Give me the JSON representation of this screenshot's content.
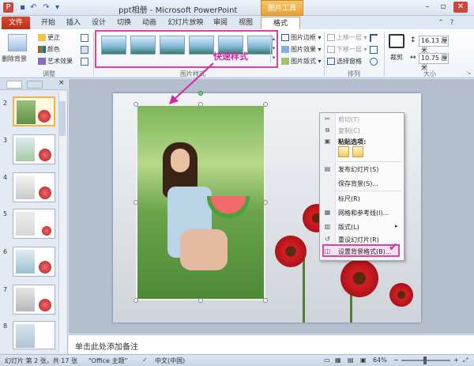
{
  "window": {
    "title": "ppt相册 - Microsoft PowerPoint",
    "context_tool_title": "图片工具"
  },
  "tabs": [
    "文件",
    "开始",
    "插入",
    "设计",
    "切换",
    "动画",
    "幻灯片放映",
    "审阅",
    "视图",
    "格式"
  ],
  "ribbon": {
    "remove_bg": "删除背景",
    "corrections": "更正",
    "color": "颜色",
    "artistic": "艺术效果",
    "adjust_group": "调整",
    "picture_styles_group": "图片样式",
    "border": "图片边框",
    "effects": "图片效果",
    "layout": "图片版式",
    "bring_forward": "上移一层",
    "send_backward": "下移一层",
    "selection_pane": "选择窗格",
    "arrange_group": "排列",
    "crop": "裁剪",
    "height": "16.13 厘米",
    "width": "10.75 厘米",
    "size_group": "大小"
  },
  "annotation": "快速样式",
  "slides": [
    "2",
    "3",
    "4",
    "5",
    "6",
    "7",
    "8"
  ],
  "context_menu": {
    "cut": "剪切(T)",
    "copy": "复制(C)",
    "paste_options": "粘贴选项:",
    "publish": "发布幻灯片(S)",
    "save_bg": "保存背景(S)...",
    "ruler": "标尺(R)",
    "grid": "网格和参考线(I)...",
    "layout": "版式(L)",
    "reset": "重设幻灯片(R)",
    "format_bg": "设置背景格式(B)..."
  },
  "notes_placeholder": "单击此处添加备注",
  "status": {
    "slide_info": "幻灯片 第 2 张，共 17 张",
    "theme": "\"Office 主题\"",
    "language": "中文(中国)",
    "zoom": "64%"
  },
  "colors": {
    "annotation": "#d4299a",
    "file_tab": "#c5381e",
    "context_tab": "#e8a13a"
  }
}
